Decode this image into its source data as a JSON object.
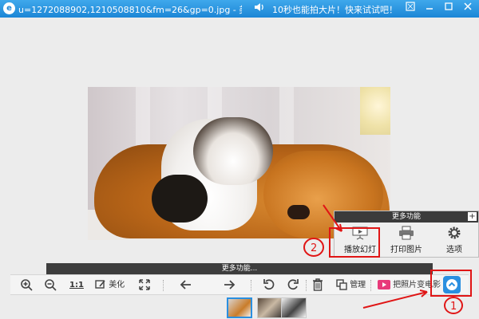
{
  "window": {
    "app_icon": "e",
    "title": "u=1272088902,1210508810&fm=26&gp=0.jpg - 美...",
    "promo_icon": "speaker-icon",
    "promo_text": "10秒也能拍大片！快来试试吧！",
    "controls": [
      "restore-icon",
      "minimize-icon",
      "maximize-icon",
      "close-icon"
    ]
  },
  "popup": {
    "title": "更多功能",
    "items": [
      {
        "label": "播放幻灯",
        "icon": "slideshow-icon"
      },
      {
        "label": "打印图片",
        "icon": "printer-icon"
      },
      {
        "label": "选项",
        "icon": "gear-icon"
      }
    ]
  },
  "toolbar": {
    "header": "更多功能...",
    "beautify_label": "美化",
    "manage_label": "管理",
    "movie_label": "把照片变电影",
    "one_to_one": "1:1",
    "icons": [
      "zoom-in-icon",
      "zoom-out-icon",
      "actual-size-icon",
      "beautify-icon",
      "fit-window-icon",
      "prev-arrow-icon",
      "next-arrow-icon",
      "rotate-left-icon",
      "rotate-right-icon",
      "delete-icon",
      "manage-icon",
      "movie-icon",
      "expand-up-icon"
    ]
  },
  "thumbnails": [
    {
      "name": "kitten-puppy",
      "active": true
    },
    {
      "name": "dog-photo",
      "active": false
    },
    {
      "name": "cat-photo",
      "active": false
    }
  ],
  "annotations": {
    "num1": "1",
    "num2": "2",
    "color": "#e01515"
  }
}
